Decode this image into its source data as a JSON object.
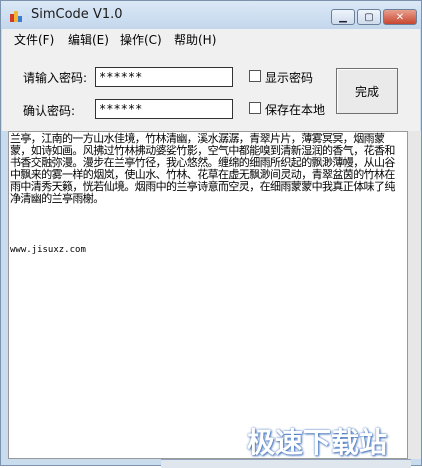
{
  "window": {
    "title": "SimCode V1.0"
  },
  "menu": [
    "文件(F)",
    "编辑(E)",
    "操作(C)",
    "帮助(H)"
  ],
  "form": {
    "password_label": "请输入密码:",
    "password_value": "******",
    "confirm_label": "确认密码:",
    "confirm_value": "******",
    "show_password_label": "显示密码",
    "save_local_label": "保存在本地",
    "done_button": "完成"
  },
  "content": {
    "body": "兰亭，江南的一方山水佳境，竹林清幽，溪水潺潺，青翠片片，薄雾冥冥，烟雨蒙蒙，如诗如画。风拂过竹林拂动婆娑竹影，空气中都能嗅到清新湿润的香气，花香和书香交融弥漫。漫步在兰亭竹径，我心悠然。缠绵的细雨所织起的飘渺薄幔，从山谷中飘来的雾一样的烟岚，使山水、竹林、花草在虚无飘渺间灵动，青翠盆茵的竹林在雨中清秀天籁，恍若仙境。烟雨中的兰亭诗意而空灵，在细雨蒙蒙中我真正体味了纯净清幽的兰亭雨榭。",
    "url": "www.jisuxz.com"
  },
  "watermark": "极速下载站",
  "colors": {
    "titlebar": "#c3d7ec",
    "close_button": "#c6462f",
    "client_bg": "#f0f0f0"
  }
}
